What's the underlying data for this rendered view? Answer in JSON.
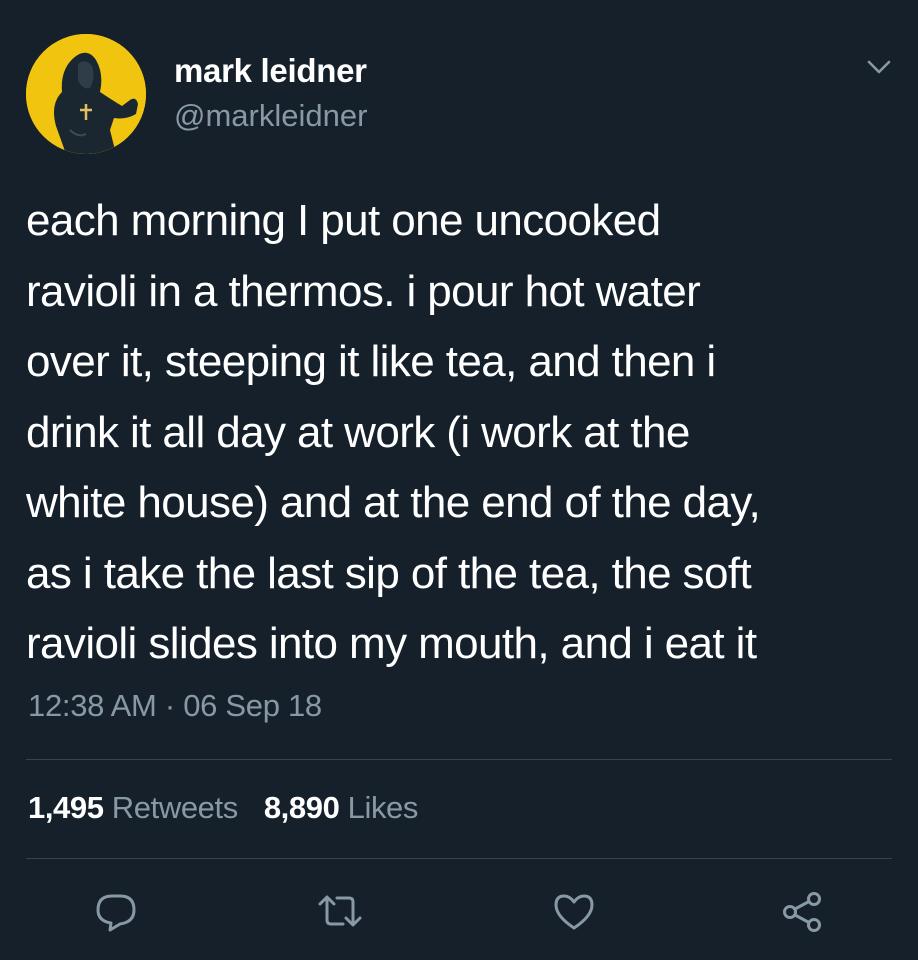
{
  "user": {
    "display_name": "mark leidner",
    "handle": "@markleidner"
  },
  "tweet": {
    "lines": [
      "each morning I put one uncooked",
      "ravioli in a thermos. i pour hot water",
      "over it, steeping it like tea, and then i",
      "drink it all day at work (i work at the",
      "white house) and at the end of the day,",
      "as i take the last sip of the tea, the soft",
      "ravioli slides into my mouth, and i eat it"
    ],
    "timestamp": "12:38 AM · 06 Sep 18"
  },
  "stats": {
    "retweets_count": "1,495",
    "retweets_label": "Retweets",
    "likes_count": "8,890",
    "likes_label": "Likes"
  },
  "icons": {
    "more": "chevron-down-icon",
    "reply": "reply-icon",
    "retweet": "retweet-icon",
    "like": "heart-icon",
    "share": "share-icon"
  },
  "colors": {
    "background": "#15202b",
    "text": "#ffffff",
    "secondary_text": "#8899a6",
    "divider": "#38444d",
    "avatar_bg": "#f1c40f"
  }
}
